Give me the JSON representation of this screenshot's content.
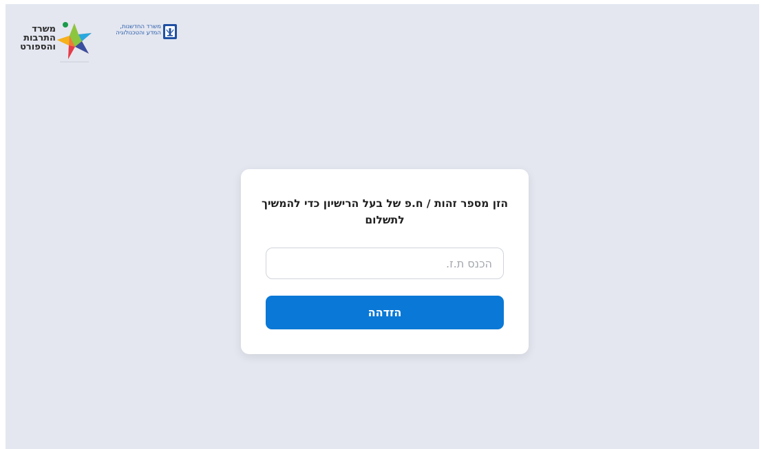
{
  "header": {
    "culture_logo": {
      "lines": [
        "משרד",
        "התרבות",
        "והספורט"
      ],
      "icon": "star-icon"
    },
    "science_logo": {
      "lines": [
        "משרד החדשנות,",
        "המדע והטכנולוגיה"
      ],
      "icon": "state-emblem-icon"
    }
  },
  "login_card": {
    "title": "הזן מספר זהות / ח.פ של בעל הרישיון כדי להמשיך לתשלום",
    "id_input": {
      "placeholder": "הכנס ת.ז.",
      "value": ""
    },
    "submit_label": "הזדהה"
  },
  "colors": {
    "background": "#e4e7f0",
    "card": "#ffffff",
    "button": "#0a78d6",
    "button_text": "#ffffff"
  }
}
